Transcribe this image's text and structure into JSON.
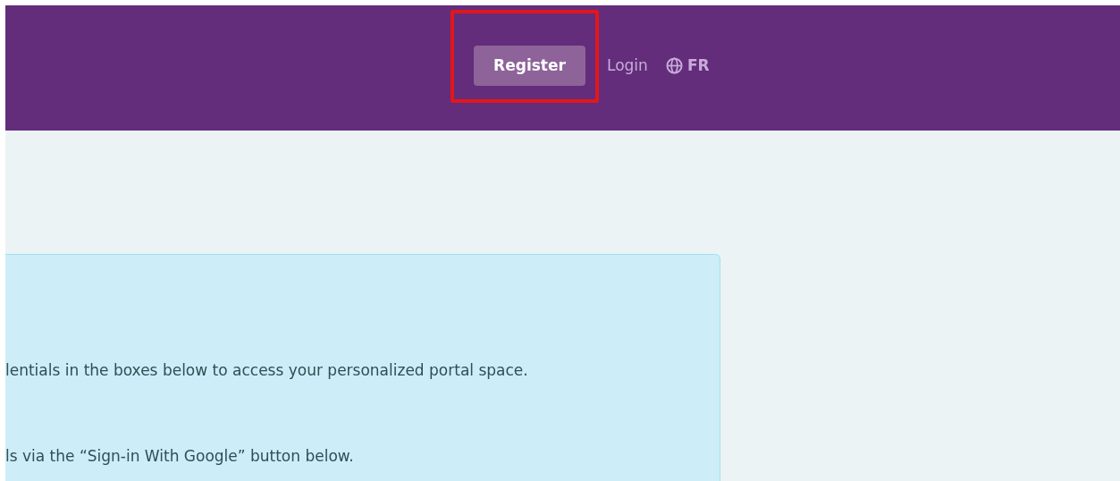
{
  "header": {
    "nav": [
      {
        "kind": "button",
        "label": "Register",
        "highlighted": true
      },
      {
        "kind": "link",
        "label": "Login",
        "highlighted": false
      },
      {
        "kind": "language",
        "label": "FR",
        "highlighted": false
      }
    ]
  },
  "info_panel": {
    "lines": [
      "lentials in the boxes below to access your personalized portal space.",
      "ls via the “Sign-in With Google” button below."
    ]
  }
}
